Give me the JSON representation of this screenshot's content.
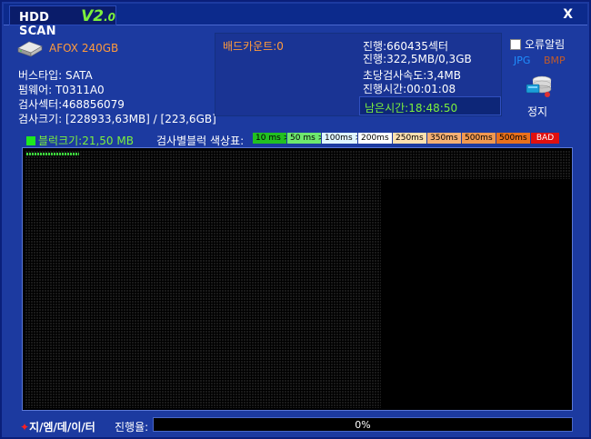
{
  "app": {
    "title": "HDD SCAN",
    "version_major": "V2",
    "version_minor": ".0",
    "close_label": "X"
  },
  "drive": {
    "name": "AFOX 240GB",
    "icon": "hard-drive-icon"
  },
  "info": {
    "bus_type": "버스타입: SATA",
    "firmware": "펌웨어: T0311A0",
    "sectors": "검사섹터:468856079",
    "size": "검사크기: [228933,63MB] / [223,6GB]"
  },
  "status": {
    "bad_count": "배드카운트:0",
    "progress_sectors": "진행:660435섹터",
    "progress_mb": "진행:322,5MB/0,3GB",
    "speed": "초당검사속도:3,4MB",
    "elapsed": "진행시간:00:01:08",
    "remaining": "남은시간:18:48:50"
  },
  "options": {
    "error_alert_label": "오류알림",
    "error_alert_checked": false,
    "format_jpg": "JPG",
    "format_bmp": "BMP",
    "stop_label": "정지"
  },
  "legend": {
    "block_size": "블럭크기:21,50 MB",
    "title": "검사별블럭 색상표:",
    "items": [
      {
        "label": "10 ms >",
        "color": "#22c022"
      },
      {
        "label": "50 ms >",
        "color": "#6ee86e"
      },
      {
        "label": "100ms >",
        "color": "#dff5ff"
      },
      {
        "label": "200ms >",
        "color": "#ffffff"
      },
      {
        "label": "250ms >",
        "color": "#fde0b0"
      },
      {
        "label": "350ms >",
        "color": "#f5b074"
      },
      {
        "label": "500ms >",
        "color": "#f09850"
      },
      {
        "label": "500ms <",
        "color": "#e8701c"
      },
      {
        "label": "BAD",
        "color": "#e01010"
      }
    ]
  },
  "footer": {
    "brand": "지/엠/데/이/터",
    "progress_label": "진행율:",
    "progress_value": 0,
    "progress_text": "0%"
  },
  "colors": {
    "window_bg": "#1c3aa0",
    "accent_orange": "#ff9a3c",
    "accent_green": "#7cf03c"
  }
}
